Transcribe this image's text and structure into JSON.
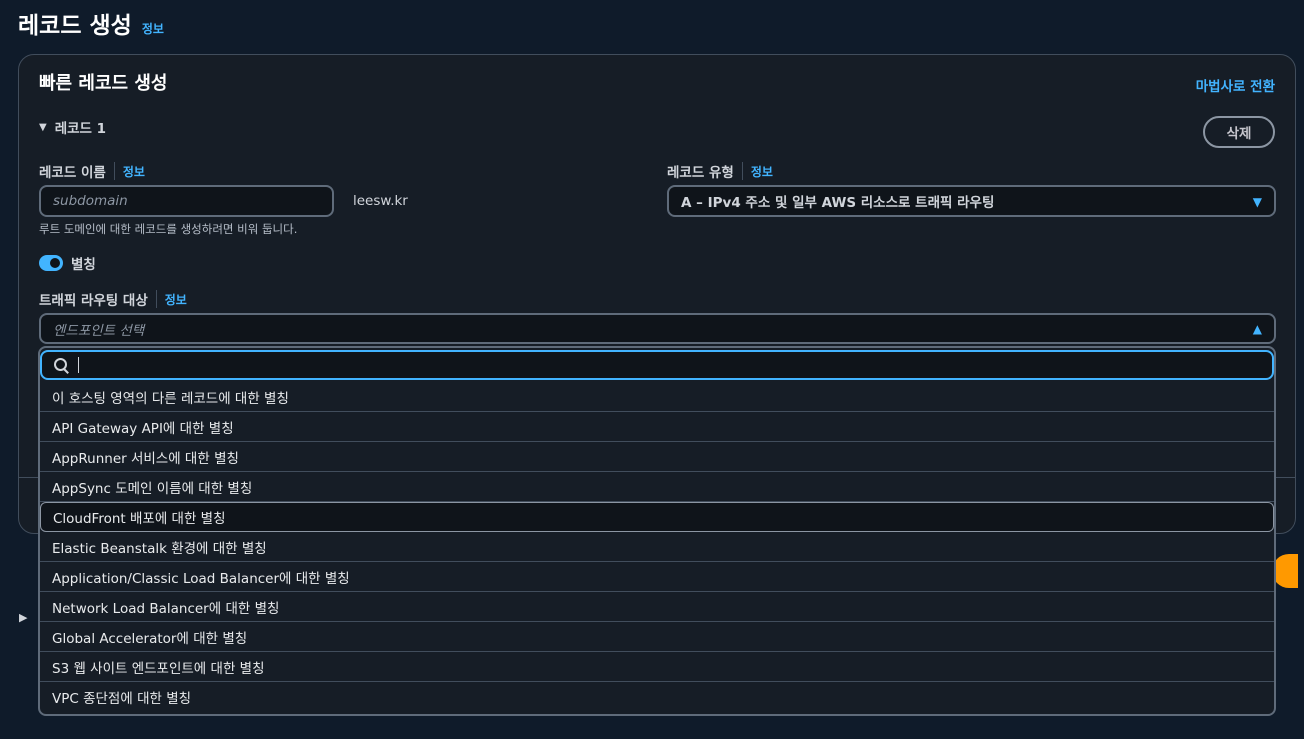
{
  "page": {
    "title": "레코드 생성",
    "info_label": "정보"
  },
  "card": {
    "title": "빠른 레코드 생성",
    "wizard_link": "마법사로 전환",
    "record_section": "레코드 1",
    "delete_button": "삭제"
  },
  "record_name": {
    "label": "레코드 이름",
    "info_label": "정보",
    "placeholder": "subdomain",
    "domain_suffix": "leesw.kr",
    "hint": "루트 도메인에 대한 레코드를 생성하려면 비워 둡니다."
  },
  "record_type": {
    "label": "레코드 유형",
    "info_label": "정보",
    "value": "A – IPv4 주소 및 일부 AWS 리소스로 트래픽 라우팅"
  },
  "alias": {
    "label": "별칭",
    "enabled": true
  },
  "traffic_target": {
    "label": "트래픽 라우팅 대상",
    "info_label": "정보",
    "placeholder": "엔드포인트 선택"
  },
  "dropdown": {
    "search_value": "",
    "highlighted_index": 4,
    "options": [
      "이 호스팅 영역의 다른 레코드에 대한 별칭",
      "API Gateway API에 대한 별칭",
      "AppRunner 서비스에 대한 별칭",
      "AppSync 도메인 이름에 대한 별칭",
      "CloudFront 배포에 대한 별칭",
      "Elastic Beanstalk 환경에 대한 별칭",
      "Application/Classic Load Balancer에 대한 별칭",
      "Network Load Balancer에 대한 별칭",
      "Global Accelerator에 대한 별칭",
      "S3 웹 사이트 엔드포인트에 대한 별칭",
      "VPC 종단점에 대한 별칭"
    ]
  },
  "colors": {
    "background": "#0f1b2a",
    "card": "#161d26",
    "accent_link": "#42b4ff",
    "primary_button": "#ff9900"
  }
}
